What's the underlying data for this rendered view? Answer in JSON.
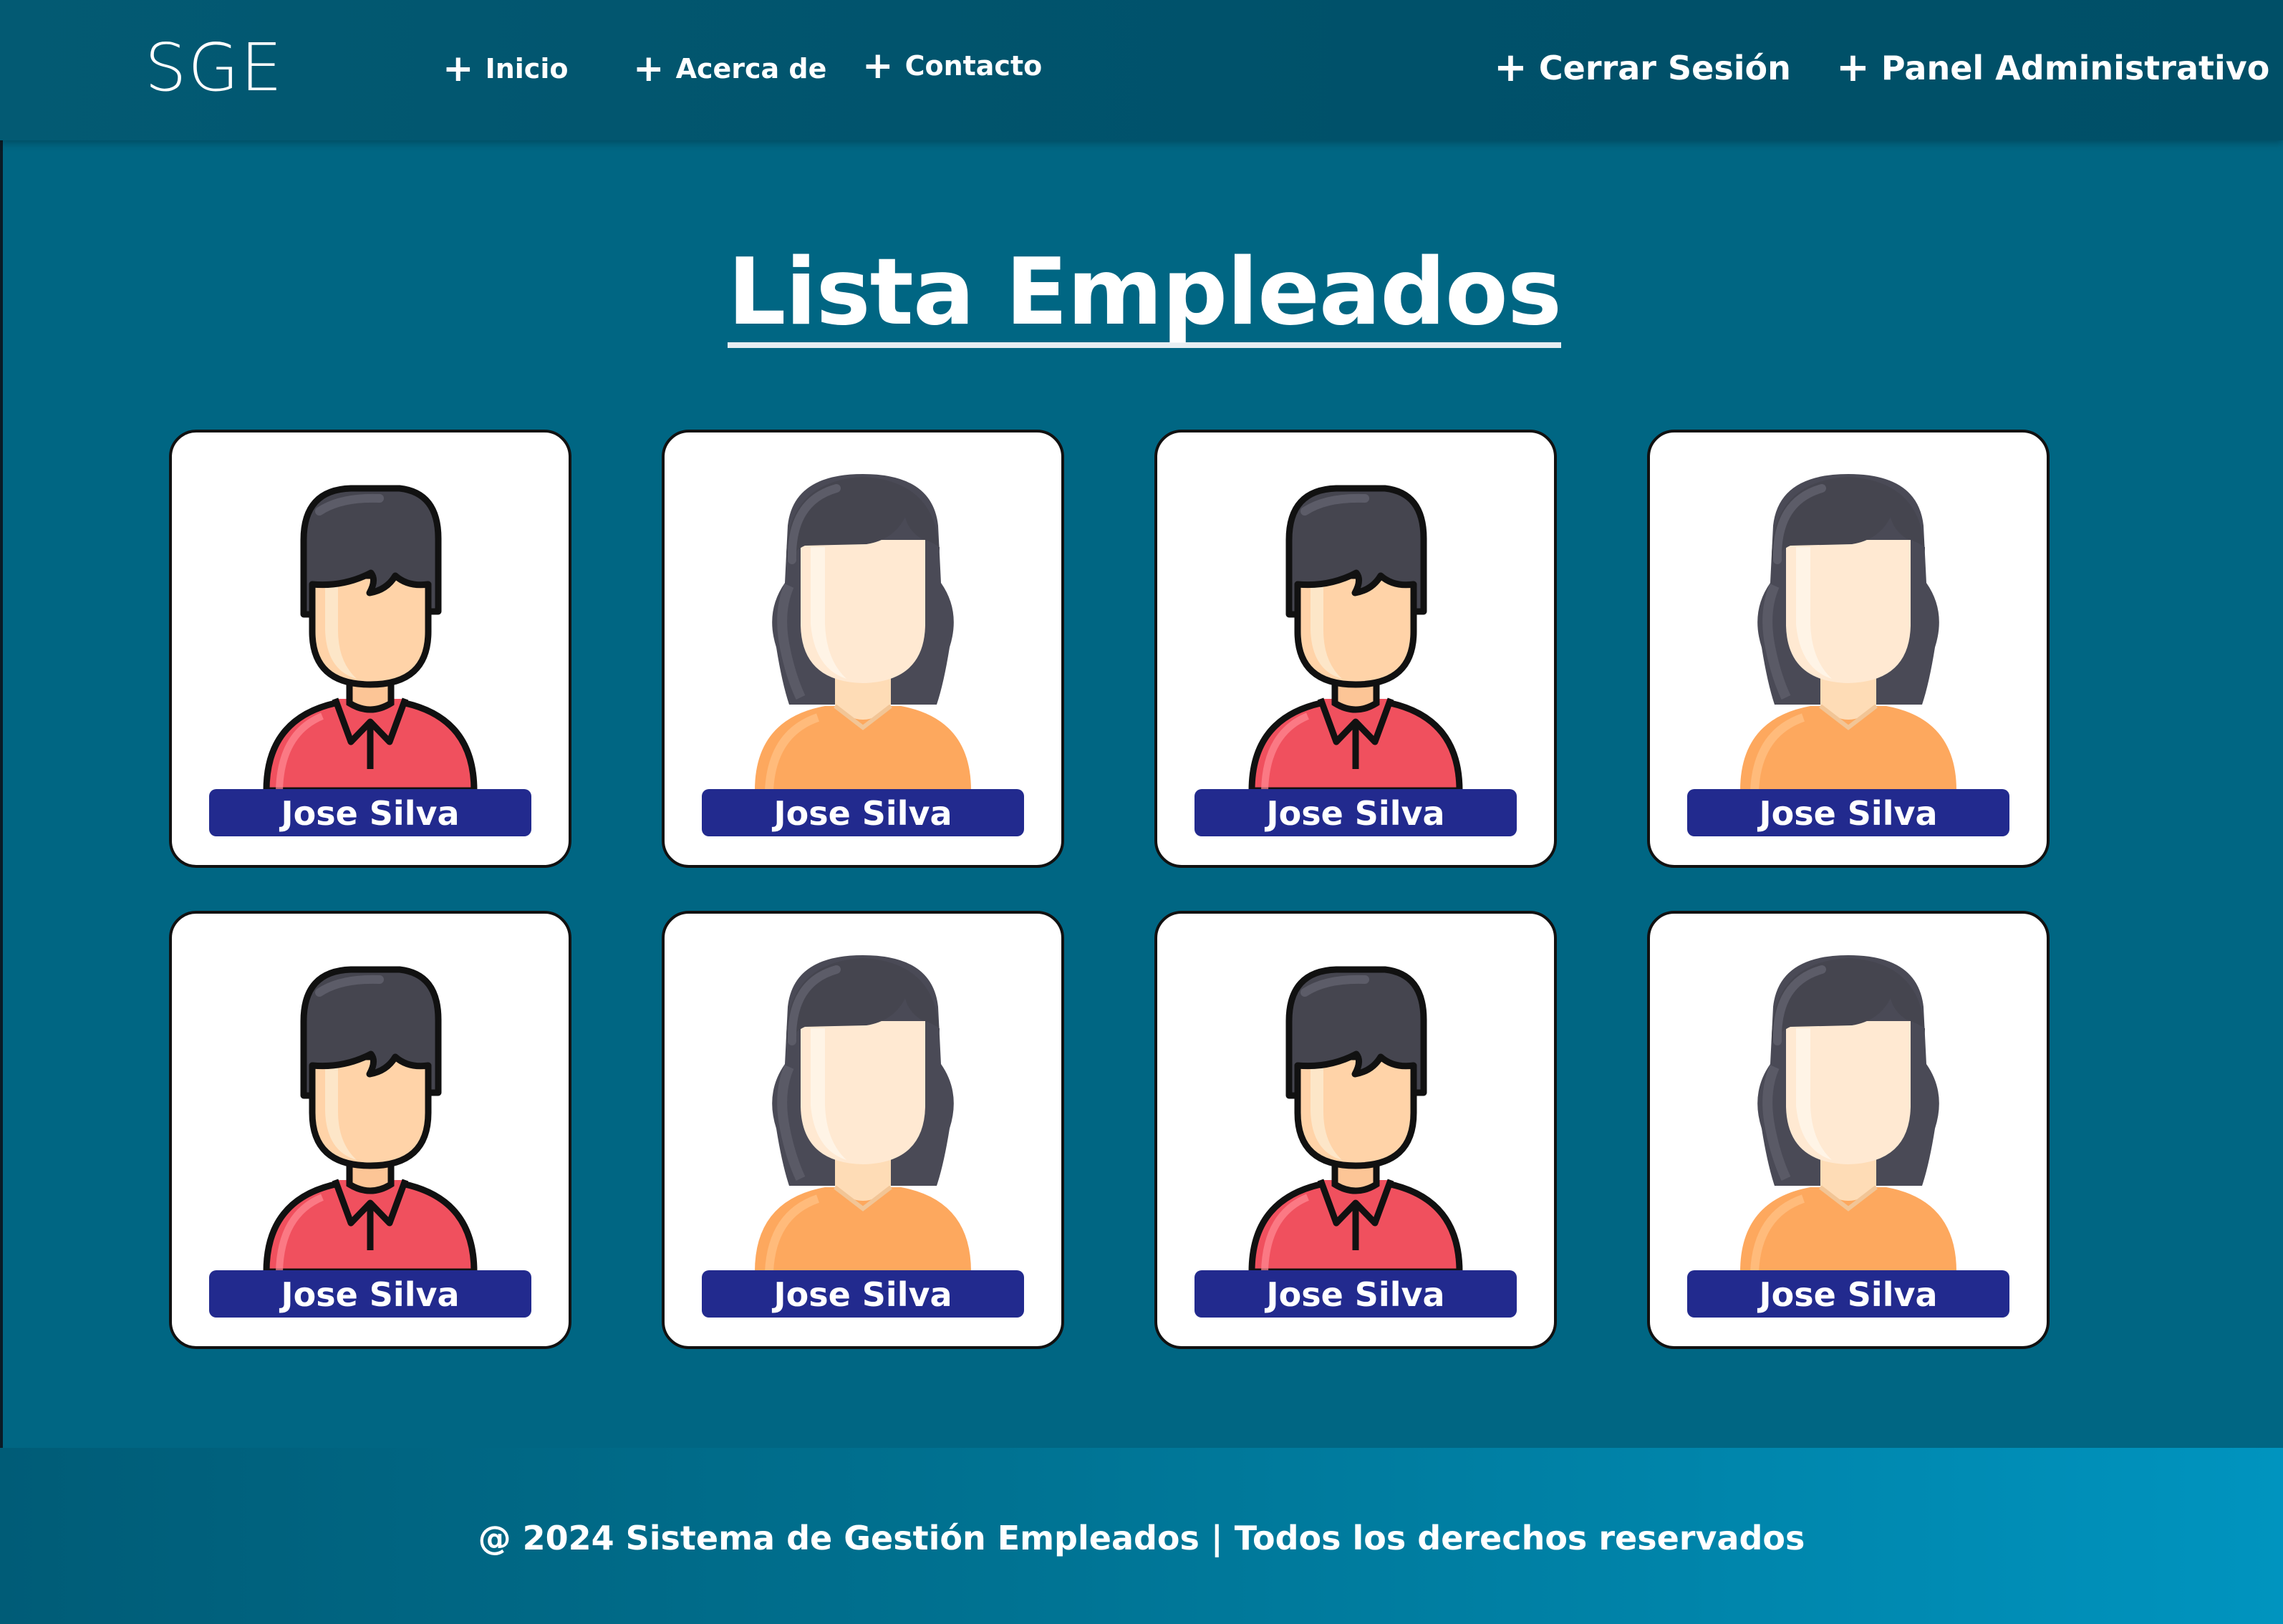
{
  "header": {
    "brand": "SGE",
    "nav_left": [
      {
        "label": "Inicio",
        "icon": "plus-icon"
      },
      {
        "label": "Acerca de",
        "icon": "plus-icon"
      },
      {
        "label": "Contacto",
        "icon": "plus-icon"
      }
    ],
    "nav_right": [
      {
        "label": "Cerrar Sesión",
        "icon": "plus-icon"
      },
      {
        "label": "Panel Administrativo",
        "icon": "plus-icon"
      }
    ],
    "plus_symbol": "+"
  },
  "main": {
    "title": "Lista Empleados",
    "employees": [
      {
        "name": "Jose Silva",
        "avatar": "male-avatar-icon"
      },
      {
        "name": "Jose Silva",
        "avatar": "female-avatar-icon"
      },
      {
        "name": "Jose Silva",
        "avatar": "male-avatar-icon"
      },
      {
        "name": "Jose Silva",
        "avatar": "female-avatar-icon"
      },
      {
        "name": "Jose Silva",
        "avatar": "male-avatar-icon"
      },
      {
        "name": "Jose Silva",
        "avatar": "female-avatar-icon"
      },
      {
        "name": "Jose Silva",
        "avatar": "male-avatar-icon"
      },
      {
        "name": "Jose Silva",
        "avatar": "female-avatar-icon"
      }
    ]
  },
  "footer": {
    "text": "@ 2024 Sistema de Gestión Empleados | Todos los derechos reservados"
  },
  "colors": {
    "header_bg": "#00516a",
    "content_bg": "#006683",
    "badge_bg": "#222a8e",
    "footer_gradient_end": "#0094bf"
  }
}
